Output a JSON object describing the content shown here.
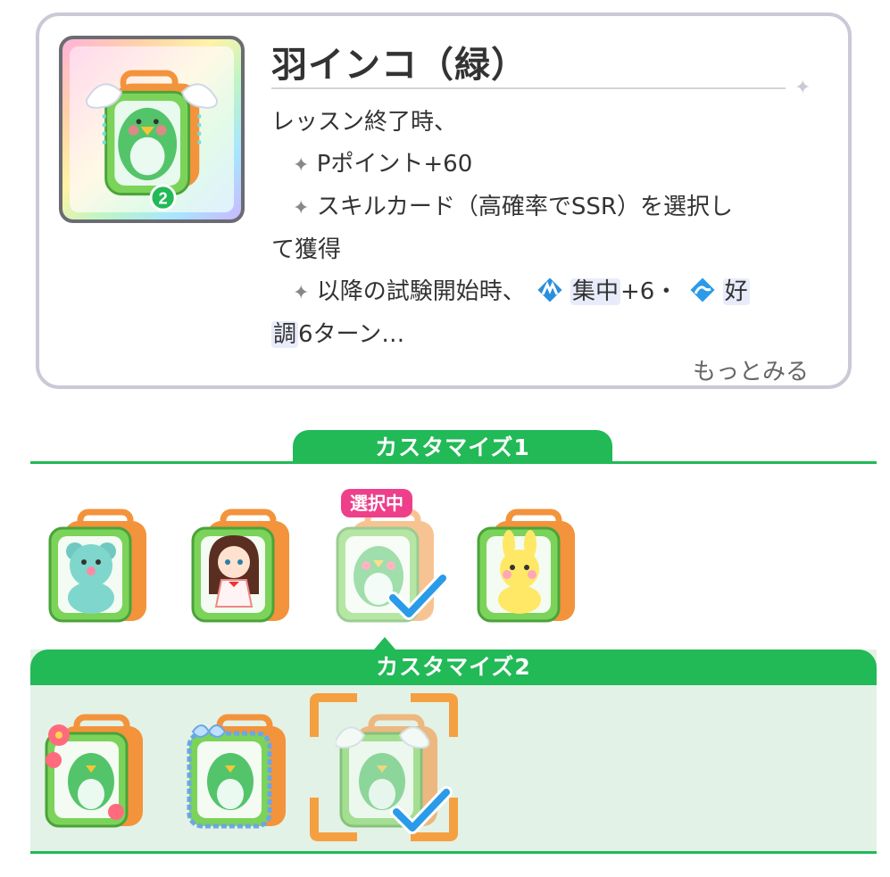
{
  "item": {
    "title": "羽インコ（緑）",
    "level": "2",
    "desc": {
      "line1": "レッスン終了時、",
      "line2": "Pポイント+60",
      "line3a": "スキルカード（高確率でSSR）を選択し",
      "line3b": "て獲得",
      "line4a": "以降の試験開始時、",
      "line4_buff1": "集中",
      "line4_buff1_val": "+6・",
      "line4_buff2": "好",
      "line5_buff2": "調",
      "line5_rest": "6ターン…"
    },
    "more_label": "もっとみる"
  },
  "customize1": {
    "label": "カスタマイズ1",
    "selected_badge": "選択中",
    "options": [
      {
        "icon": "bear-plush-bag-icon"
      },
      {
        "icon": "doll-plush-bag-icon"
      },
      {
        "icon": "parakeet-plush-bag-icon",
        "selected": true
      },
      {
        "icon": "bunny-plush-bag-icon"
      }
    ]
  },
  "customize2": {
    "label": "カスタマイズ2",
    "options": [
      {
        "icon": "flower-decor-bag-icon"
      },
      {
        "icon": "ribbon-decor-bag-icon"
      },
      {
        "icon": "wing-decor-bag-icon",
        "selected": true,
        "focused": true
      }
    ]
  },
  "colors": {
    "green": "#22b957",
    "pink_badge": "#ee3f8a",
    "check_blue": "#2a9be8",
    "focus_orange": "#f5a040",
    "card_border": "#c9cad6"
  }
}
